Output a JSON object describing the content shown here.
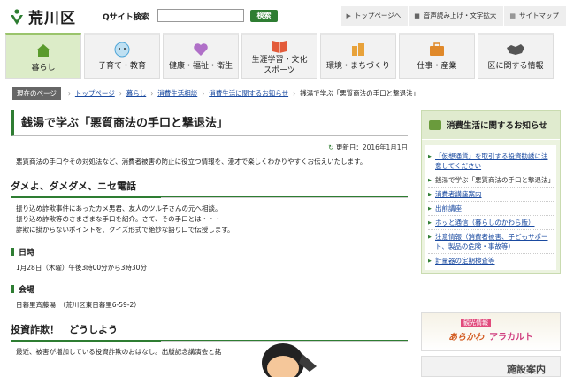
{
  "header": {
    "logo_text": "荒川区",
    "search_label": "Qサイト検索",
    "search_placeholder": "",
    "search_button": "検索",
    "util_links": [
      {
        "icon": "home-icon",
        "label": "トップページへ"
      },
      {
        "icon": "speaker-icon",
        "label": "音声読み上げ・文字拡大"
      },
      {
        "icon": "sitemap-icon",
        "label": "サイトマップ"
      }
    ]
  },
  "gnav": [
    {
      "label": "暮らし",
      "icon": "house-icon",
      "color": "#5a9b2c"
    },
    {
      "label": "子育て・教育",
      "icon": "child-face-icon",
      "color": "#4fa6d8"
    },
    {
      "label": "健康・福祉・衛生",
      "icon": "heart-icon",
      "color": "#b070c8"
    },
    {
      "label1": "生涯学習・文化",
      "label2": "スポーツ",
      "icon": "book-icon",
      "color": "#e35b3a"
    },
    {
      "label": "環境・まちづくり",
      "icon": "building-icon",
      "color": "#e8a23a"
    },
    {
      "label": "仕事・産業",
      "icon": "briefcase-icon",
      "color": "#e0892a"
    },
    {
      "label": "区に関する情報",
      "icon": "map-icon",
      "color": "#555555"
    }
  ],
  "breadcrumb": {
    "here": "現在のページ",
    "items": [
      "トップページ",
      "暮らし",
      "消費生活相談",
      "消費生活に関するお知らせ",
      "銭湯で学ぶ「悪質商法の手口と撃退法」"
    ]
  },
  "article": {
    "title": "銭湯で学ぶ「悪質商法の手口と撃退法」",
    "updated": "更新日：2016年1月1日",
    "lead": "悪質商法の手口やその対処法など、消費者被害の防止に役立つ情報を、漫才で楽しくわかりやすくお伝えいたします。",
    "section1_title": "ダメよ、ダメダメ、ニセ電話",
    "section1_lines": [
      "振り込め詐欺事件にあったカメ男君、友人のツル子さんの元へ相談。",
      "振り込め詐欺等のさまざまな手口を紹介。さて、その手口とは・・・",
      "詐欺に掛からないポイントを、クイズ形式で絶妙な語り口で伝授します。"
    ],
    "when_label": "日時",
    "when_value": "1月28日（木曜）午後3時00分から3時30分",
    "where_label": "会場",
    "where_value": "日暮里斉藤湯　（荒川区東日暮里6-59-2）",
    "section2_title": "投資詐欺！　どうしよう",
    "section2_line": "最近、被害が増加している投資詐欺のおはなし。出版記念講演会と銘"
  },
  "sidebar": {
    "title": "消費生活に関するお知らせ",
    "items": [
      {
        "label": "「仮想通貨」を取引する投資勧誘に注意してください",
        "current": false
      },
      {
        "label": "銭湯で学ぶ「悪質商法の手口と撃退法」",
        "current": true
      },
      {
        "label": "消費者講座案内",
        "current": false
      },
      {
        "label": "出前講座",
        "current": false
      },
      {
        "label": "ホッと通信（暮らしのかわら版）",
        "current": false
      },
      {
        "label": "注意情報（消費者被害、子どもサポート、製品の危険・事故等）",
        "current": false
      },
      {
        "label": "計量器の定期検査等",
        "current": false
      }
    ],
    "banner_tag": "観光情報",
    "banner_title": "あらかわ",
    "banner_title2": "アラカルト",
    "facility": "施設案内"
  }
}
